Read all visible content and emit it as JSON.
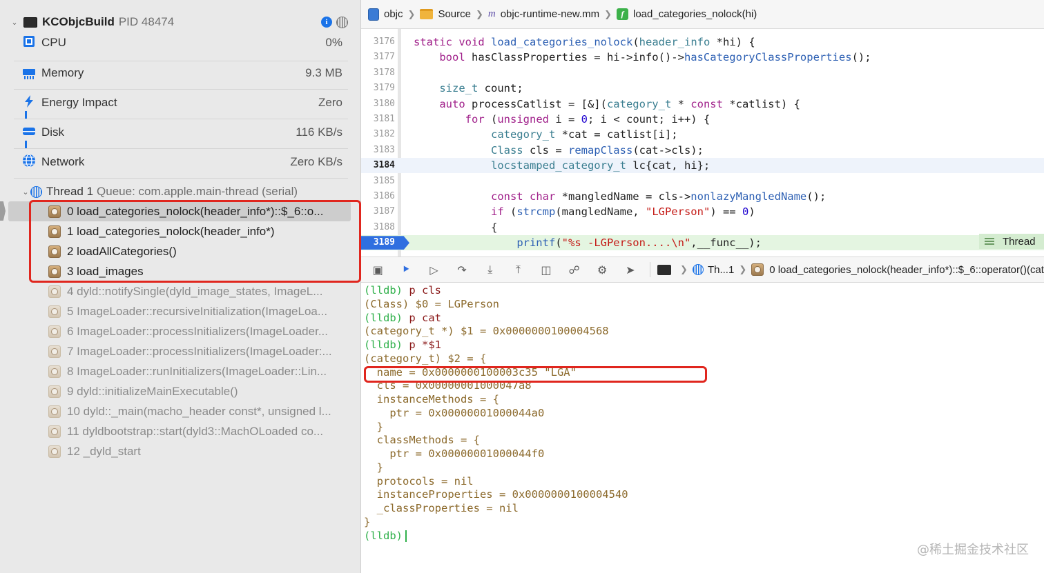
{
  "process": {
    "name": "KCObjcBuild",
    "pid_label": "PID 48474",
    "info_icon": "i"
  },
  "gauges": [
    {
      "label": "CPU",
      "value": "0%",
      "icon": "cpu-icon"
    },
    {
      "label": "Memory",
      "value": "9.3 MB",
      "icon": "memory-icon"
    },
    {
      "label": "Energy Impact",
      "value": "Zero",
      "icon": "energy-icon"
    },
    {
      "label": "Disk",
      "value": "116 KB/s",
      "icon": "disk-icon"
    },
    {
      "label": "Network",
      "value": "Zero KB/s",
      "icon": "network-icon"
    }
  ],
  "thread": {
    "label": "Thread 1",
    "queue": "Queue: com.apple.main-thread (serial)"
  },
  "frames": [
    "0 load_categories_nolock(header_info*)::$_6::o...",
    "1 load_categories_nolock(header_info*)",
    "2 loadAllCategories()",
    "3 load_images",
    "4 dyld::notifySingle(dyld_image_states, ImageL...",
    "5 ImageLoader::recursiveInitialization(ImageLoa...",
    "6 ImageLoader::processInitializers(ImageLoader...",
    "7 ImageLoader::processInitializers(ImageLoader:...",
    "8 ImageLoader::runInitializers(ImageLoader::Lin...",
    "9 dyld::initializeMainExecutable()",
    "10 dyld::_main(macho_header const*, unsigned l...",
    "11 dyldbootstrap::start(dyld3::MachOLoaded co...",
    "12 _dyld_start"
  ],
  "jumpbar": {
    "crumbs": [
      "objc",
      "Source",
      "objc-runtime-new.mm",
      "load_categories_nolock(hi)"
    ],
    "file_icon_letter": "m",
    "func_icon_letter": "f"
  },
  "editor": {
    "lines": [
      {
        "n": "3176",
        "code": "static void load_categories_nolock(header_info *hi) {"
      },
      {
        "n": "3177",
        "code": "    bool hasClassProperties = hi->info()->hasCategoryClassProperties();"
      },
      {
        "n": "3178",
        "code": ""
      },
      {
        "n": "3179",
        "code": "    size_t count;"
      },
      {
        "n": "3180",
        "code": "    auto processCatlist = [&](category_t * const *catlist) {"
      },
      {
        "n": "3181",
        "code": "        for (unsigned i = 0; i < count; i++) {"
      },
      {
        "n": "3182",
        "code": "            category_t *cat = catlist[i];"
      },
      {
        "n": "3183",
        "code": "            Class cls = remapClass(cat->cls);"
      },
      {
        "n": "3184",
        "code": "            locstamped_category_t lc{cat, hi};"
      },
      {
        "n": "3185",
        "code": ""
      },
      {
        "n": "3186",
        "code": "            const char *mangledName = cls->nonlazyMangledName();"
      },
      {
        "n": "3187",
        "code": "            if (strcmp(mangledName, \"LGPerson\") == 0)"
      },
      {
        "n": "3188",
        "code": "            {"
      },
      {
        "n": "3189",
        "code": "                printf(\"%s -LGPerson....\\n\",__func__);"
      }
    ],
    "current_line": "3184",
    "pc_line": "3189",
    "thread_badge": "Thread"
  },
  "debugbar": {
    "thread_crumb": "Th...1",
    "frame_crumb": "0 load_categories_nolock(header_info*)::$_6::operator()(cat"
  },
  "console": {
    "lines": [
      {
        "kind": "cmd",
        "prompt": "(lldb)",
        "text": " p cls"
      },
      {
        "kind": "out",
        "text": "(Class) $0 = LGPerson"
      },
      {
        "kind": "cmd",
        "prompt": "(lldb)",
        "text": " p cat"
      },
      {
        "kind": "out",
        "text": "(category_t *) $1 = 0x0000000100004568"
      },
      {
        "kind": "cmd",
        "prompt": "(lldb)",
        "text": " p *$1"
      },
      {
        "kind": "out",
        "text": "(category_t) $2 = {"
      },
      {
        "kind": "out",
        "text": "  name = 0x0000000100003c35 \"LGA\""
      },
      {
        "kind": "out",
        "text": "  cls = 0x00000001000047a8"
      },
      {
        "kind": "out",
        "text": "  instanceMethods = {"
      },
      {
        "kind": "out",
        "text": "    ptr = 0x00000001000044a0"
      },
      {
        "kind": "out",
        "text": "  }"
      },
      {
        "kind": "out",
        "text": "  classMethods = {"
      },
      {
        "kind": "out",
        "text": "    ptr = 0x00000001000044f0"
      },
      {
        "kind": "out",
        "text": "  }"
      },
      {
        "kind": "out",
        "text": "  protocols = nil"
      },
      {
        "kind": "out",
        "text": "  instanceProperties = 0x0000000100004540"
      },
      {
        "kind": "out",
        "text": "  _classProperties = nil"
      },
      {
        "kind": "out",
        "text": "}"
      },
      {
        "kind": "cmd",
        "prompt": "(lldb)",
        "text": ""
      }
    ],
    "watermark": "@稀土掘金技术社区"
  },
  "colors": {
    "accent": "#2f6fe0",
    "highlight_box": "#e0261e",
    "prompt": "#2fb04a",
    "pc_line_bg": "#e4f5e1"
  }
}
